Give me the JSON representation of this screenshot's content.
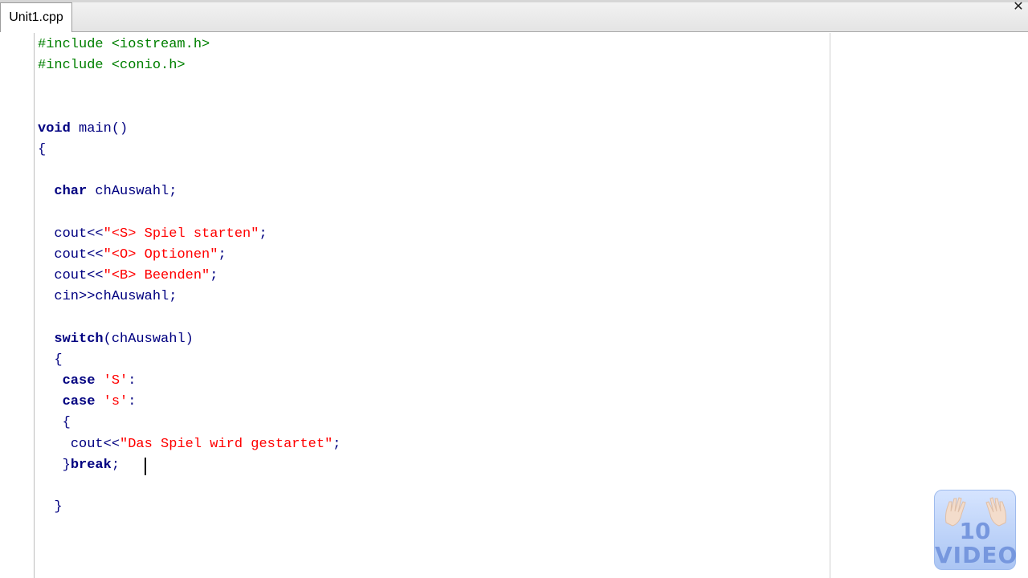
{
  "tab": {
    "label": "Unit1.cpp"
  },
  "window": {
    "close_glyph": "✕"
  },
  "code": {
    "l1": {
      "pp": "#include <iostream.h>"
    },
    "l2": {
      "pp": "#include <conio.h>"
    },
    "l3": {
      "kw": "void",
      "rest": " main()"
    },
    "l4": {
      "text": "{"
    },
    "l5": {
      "indent": "  ",
      "kw": "char",
      "rest": " chAuswahl;"
    },
    "l6": {
      "indent": "  ",
      "a": "cout<<",
      "s": "\"<S> Spiel starten\"",
      "b": ";"
    },
    "l7": {
      "indent": "  ",
      "a": "cout<<",
      "s": "\"<O> Optionen\"",
      "b": ";"
    },
    "l8": {
      "indent": "  ",
      "a": "cout<<",
      "s": "\"<B> Beenden\"",
      "b": ";"
    },
    "l9": {
      "indent": "  ",
      "a": "cin>>chAuswahl;"
    },
    "l10": {
      "indent": "  ",
      "kw": "switch",
      "rest": "(chAuswahl)"
    },
    "l11": {
      "text": "  {"
    },
    "l12": {
      "indent": "   ",
      "kw": "case",
      "sp": " ",
      "s": "'S'",
      "b": ":"
    },
    "l13": {
      "indent": "   ",
      "kw": "case",
      "sp": " ",
      "s": "'s'",
      "b": ":"
    },
    "l14": {
      "text": "   {"
    },
    "l15": {
      "indent": "    ",
      "a": "cout<<",
      "s": "\"Das Spiel wird gestartet\"",
      "b": ";"
    },
    "l16": {
      "indent": "   ",
      "a": "}",
      "kw": "break",
      "b": "; "
    },
    "l17": {
      "text": "  }"
    }
  },
  "logo": {
    "number": "10",
    "word": "VIDEO",
    "icon": "hands-icon"
  }
}
